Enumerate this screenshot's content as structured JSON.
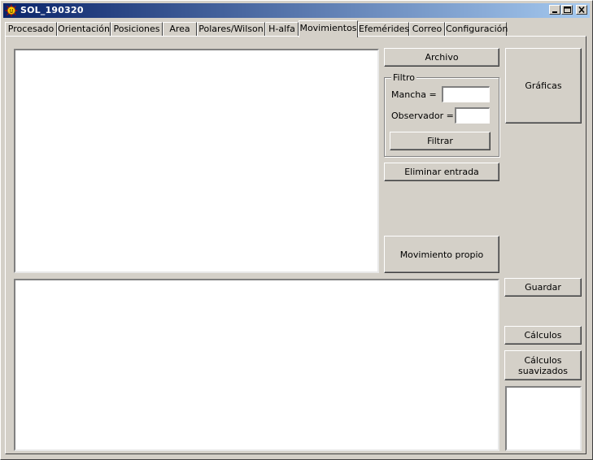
{
  "window": {
    "title": "SOL_190320",
    "icon": "sun-icon",
    "controls": {
      "minimize": "minimize-icon",
      "maximize": "maximize-icon",
      "close": "close-icon"
    }
  },
  "tabs": [
    {
      "label": "Procesado"
    },
    {
      "label": "Orientación"
    },
    {
      "label": "Posiciones"
    },
    {
      "label": "Area"
    },
    {
      "label": "Polares/Wilson"
    },
    {
      "label": "H-alfa"
    },
    {
      "label": "Movimientos"
    },
    {
      "label": "Efemérides"
    },
    {
      "label": "Correo"
    },
    {
      "label": "Configuración"
    }
  ],
  "active_tab": "Movimientos",
  "movimientos": {
    "archivo_label": "Archivo",
    "graficas_label": "Gráficas",
    "filtro": {
      "legend": "Filtro",
      "mancha_label": "Mancha =",
      "mancha_value": "",
      "observador_label": "Observador =",
      "observador_value": "",
      "filtrar_label": "Filtrar"
    },
    "eliminar_label": "Eliminar entrada",
    "movimiento_propio_label": "Movimiento propio",
    "guardar_label": "Guardar",
    "calculos_label": "Cálculos",
    "calculos_suavizados_label": "Cálculos suavizados"
  }
}
